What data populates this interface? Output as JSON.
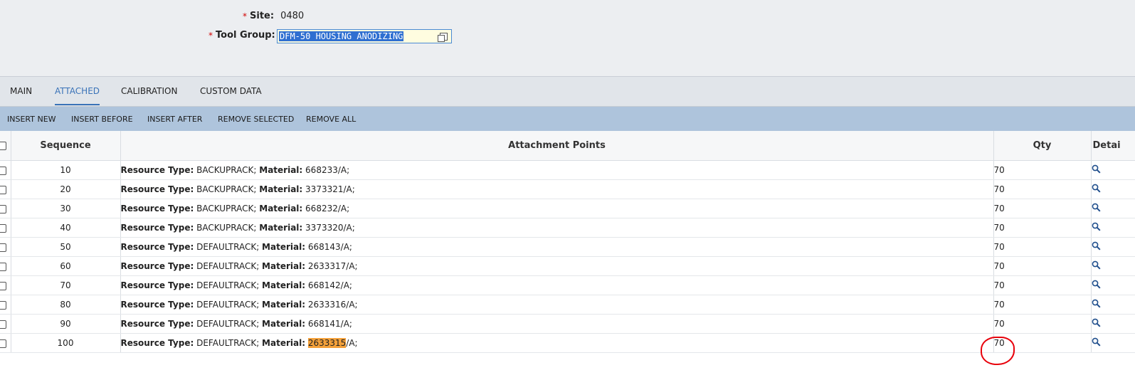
{
  "form": {
    "required_mark": "*",
    "site_label": "Site:",
    "site_value": "0480",
    "tool_group_label": "Tool Group:",
    "tool_group_value": "DFM-50 HOUSING ANODIZING",
    "tool_group_browse_icon": "browse-icon"
  },
  "tabs": [
    {
      "label": "MAIN",
      "active": false
    },
    {
      "label": "ATTACHED",
      "active": true
    },
    {
      "label": "CALIBRATION",
      "active": false
    },
    {
      "label": "CUSTOM DATA",
      "active": false
    }
  ],
  "toolbar": {
    "insert_new": "INSERT NEW",
    "insert_before": "INSERT BEFORE",
    "insert_after": "INSERT AFTER",
    "remove_selected": "REMOVE SELECTED",
    "remove_all": "REMOVE ALL"
  },
  "grid": {
    "columns": {
      "sequence": "Sequence",
      "attachment_points": "Attachment Points",
      "qty": "Qty",
      "details": "Detai"
    },
    "resource_type_label": "Resource Type:",
    "material_label": "Material:",
    "rows": [
      {
        "sequence": "10",
        "resource_type": "BACKUPRACK",
        "material": "668233",
        "suffix": "/A;",
        "qty": "70",
        "checked": false
      },
      {
        "sequence": "20",
        "resource_type": "BACKUPRACK",
        "material": "3373321",
        "suffix": "/A;",
        "qty": "70",
        "checked": false
      },
      {
        "sequence": "30",
        "resource_type": "BACKUPRACK",
        "material": "668232",
        "suffix": "/A;",
        "qty": "70",
        "checked": false
      },
      {
        "sequence": "40",
        "resource_type": "BACKUPRACK",
        "material": "3373320",
        "suffix": "/A;",
        "qty": "70",
        "checked": false
      },
      {
        "sequence": "50",
        "resource_type": "DEFAULTRACK",
        "material": "668143",
        "suffix": "/A;",
        "qty": "70",
        "checked": false
      },
      {
        "sequence": "60",
        "resource_type": "DEFAULTRACK",
        "material": "2633317",
        "suffix": "/A;",
        "qty": "70",
        "checked": false
      },
      {
        "sequence": "70",
        "resource_type": "DEFAULTRACK",
        "material": "668142",
        "suffix": "/A;",
        "qty": "70",
        "checked": false
      },
      {
        "sequence": "80",
        "resource_type": "DEFAULTRACK",
        "material": "2633316",
        "suffix": "/A;",
        "qty": "70",
        "checked": false
      },
      {
        "sequence": "90",
        "resource_type": "DEFAULTRACK",
        "material": "668141",
        "suffix": "/A;",
        "qty": "70",
        "checked": false
      },
      {
        "sequence": "100",
        "resource_type": "DEFAULTRACK",
        "material": "2633315",
        "suffix": "/A;",
        "qty": "70",
        "checked": false,
        "material_highlighted": true,
        "qty_circled": true
      }
    ]
  },
  "colors": {
    "accent": "#3a73b8",
    "toolbar_bg": "#aec4dc",
    "highlight": "#f4a13a",
    "annotation_red": "#e8000b"
  }
}
